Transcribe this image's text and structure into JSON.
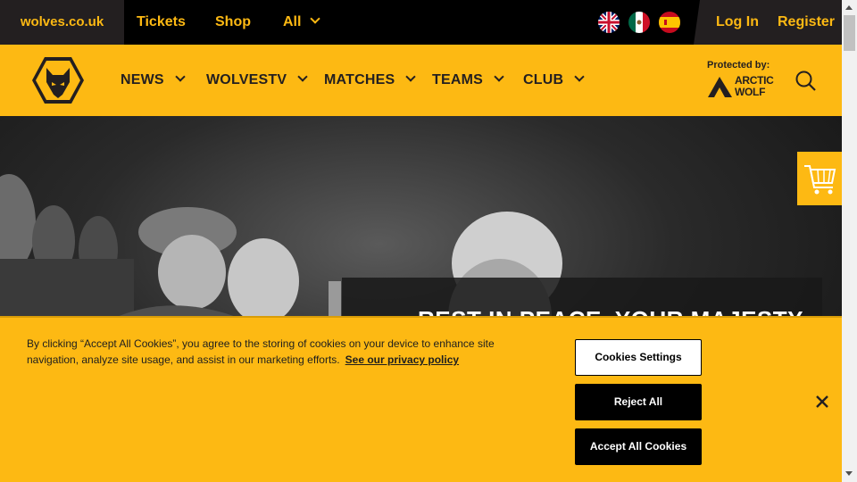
{
  "topbar": {
    "site": "wolves.co.uk",
    "links": [
      "Tickets",
      "Shop",
      "All"
    ],
    "flags": [
      "uk-flag-icon",
      "mexico-flag-icon",
      "spain-flag-icon"
    ],
    "login": "Log In",
    "register": "Register"
  },
  "nav": {
    "items": [
      "NEWS",
      "WOLVESTV",
      "MATCHES",
      "TEAMS",
      "CLUB"
    ],
    "protected_by": "Protected by:",
    "sponsor_line1": "ARCTIC",
    "sponsor_line2": "WOLF"
  },
  "hero": {
    "headline": "REST IN PEACE, YOUR MAJESTY"
  },
  "cookie": {
    "text": "By clicking “Accept All Cookies”, you agree to the storing of cookies on your device to enhance site navigation, analyze site usage, and assist in our marketing efforts.",
    "link": "See our privacy policy",
    "settings": "Cookies Settings",
    "reject": "Reject All",
    "accept": "Accept All Cookies"
  },
  "colors": {
    "brand_gold": "#fdb913",
    "dark": "#231f20"
  }
}
